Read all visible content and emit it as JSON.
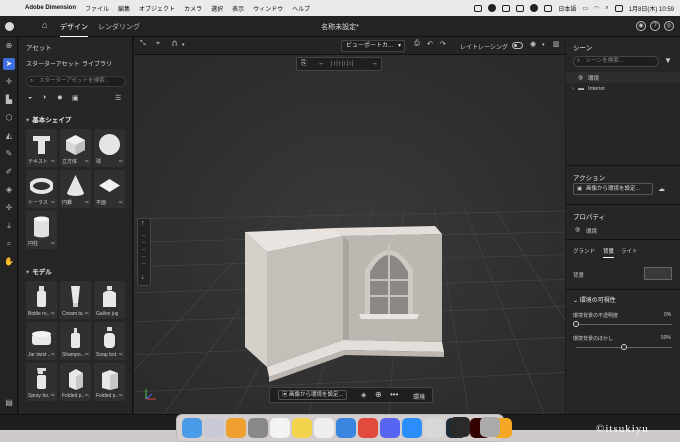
{
  "menubar": {
    "app_name": "Adobe Dimension",
    "items": [
      "ファイル",
      "編集",
      "オブジェクト",
      "カメラ",
      "選択",
      "表示",
      "ウィンドウ",
      "ヘルプ"
    ],
    "input_method": "日本語",
    "datetime": "1月8日(木) 10:59"
  },
  "app": {
    "tabs": [
      "デザイン",
      "レンダリング"
    ],
    "active_tab": "デザイン",
    "document_title": "名称未設定*"
  },
  "assets": {
    "title": "アセット",
    "subtabs": [
      "スターターアセット",
      "ライブラリ"
    ],
    "search_placeholder": "スターターアセットを検索...",
    "basic_shapes_header": "基本シェイプ",
    "basic_shapes": [
      {
        "label": "テキスト",
        "icon": "text-shape-icon"
      },
      {
        "label": "立方体",
        "icon": "cube-icon"
      },
      {
        "label": "球",
        "icon": "sphere-icon"
      },
      {
        "label": "トーラス",
        "icon": "torus-icon"
      },
      {
        "label": "円錐",
        "icon": "cone-icon"
      },
      {
        "label": "平面",
        "icon": "plane-icon"
      },
      {
        "label": "円柱",
        "icon": "cylinder-icon"
      }
    ],
    "models_header": "モデル",
    "models": [
      {
        "label": "Bottle ro...",
        "icon": "bottle-icon"
      },
      {
        "label": "Cream tu...",
        "icon": "cream-tube-icon"
      },
      {
        "label": "Gallon jug",
        "icon": "gallon-jug-icon"
      },
      {
        "label": "Jar twist ...",
        "icon": "jar-icon"
      },
      {
        "label": "Shampo...",
        "icon": "shampoo-icon"
      },
      {
        "label": "Soap bot...",
        "icon": "soap-bottle-icon"
      },
      {
        "label": "Spray bo...",
        "icon": "spray-bottle-icon"
      },
      {
        "label": "Folded p...",
        "icon": "folded-box-icon"
      },
      {
        "label": "Folded p...",
        "icon": "folded-box-icon"
      }
    ]
  },
  "viewport": {
    "view_dropdown": "ビューポートカ...",
    "raytracing_label": "レイトレーシング",
    "set_env_from_image": "画像から環境を設定...",
    "env_label": "環境"
  },
  "right_panel": {
    "scene_title": "シーン",
    "scene_search_placeholder": "シーンを検索...",
    "scene_items": [
      "環境",
      "Interior"
    ],
    "actions_title": "アクション",
    "action_button": "画像から環境を設定...",
    "properties_title": "プロパティ",
    "properties_item": "環境",
    "prop_tabs": [
      "グランド",
      "背景",
      "ライト"
    ],
    "active_prop_tab": "背景",
    "background_label": "背景",
    "visibility_title": "環境の可視性",
    "opacity_label": "環境背景の不透明度",
    "opacity_value": "0%",
    "blur_label": "環境背景のぼかし",
    "blur_value": "50%",
    "opacity_fraction": 0.0,
    "blur_fraction": 0.5
  },
  "colors": {
    "accent": "#3f6ee0",
    "panel_bg": "#262626",
    "viewport_bg": "#2d2d2d",
    "model_color": "#bdb7b2"
  },
  "watermark": "©itsukiyu"
}
